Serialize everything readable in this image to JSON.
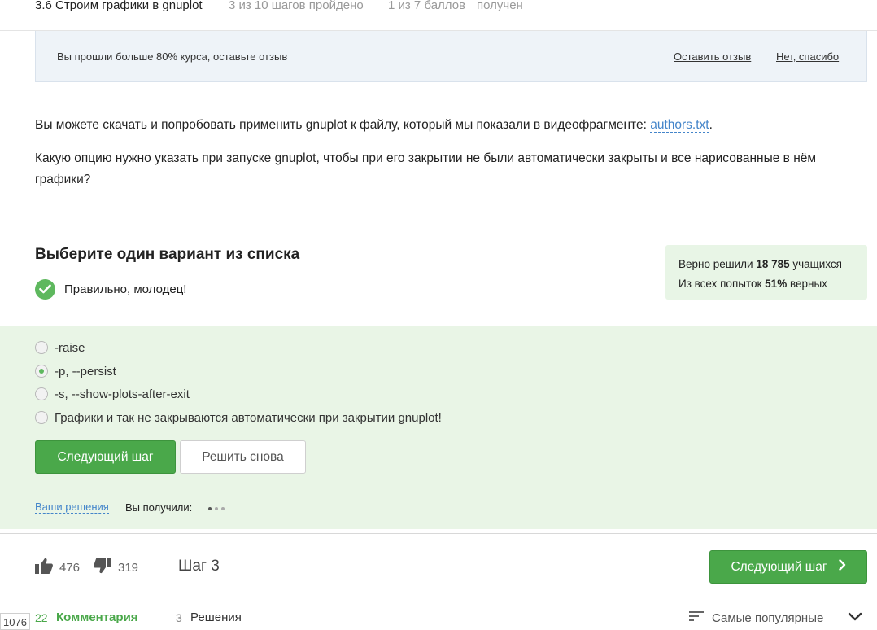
{
  "header": {
    "breadcrumb": "3.6 Строим графики в gnuplot",
    "steps_progress": "3 из 10 шагов пройдено",
    "points_progress": "1 из 7 баллов",
    "points_suffix": "получен"
  },
  "banner": {
    "message": "Вы прошли больше 80% курса, оставьте отзыв",
    "leave_review": "Оставить отзыв",
    "no_thanks": "Нет, спасибо"
  },
  "content": {
    "download_text": "Вы можете скачать и попробовать применить gnuplot к файлу, который мы показали в видеофрагменте: ",
    "download_link": "authors.txt",
    "download_end": ".",
    "question": "Какую опцию нужно указать при запуске gnuplot, чтобы при его закрытии не были автоматически закрыты и все нарисованные в нём графики?"
  },
  "quiz": {
    "title": "Выберите один вариант из списка",
    "status": "Правильно, молодец!",
    "stats": {
      "solved_prefix": "Верно решили",
      "solved_count": "18 785",
      "solved_suffix": "учащихся",
      "attempts_prefix": "Из всех попыток",
      "attempts_percent": "51%",
      "attempts_suffix": "верных"
    },
    "options": [
      {
        "label": "-raise",
        "selected": false
      },
      {
        "label": "-p, --persist",
        "selected": true
      },
      {
        "label": "-s, --show-plots-after-exit",
        "selected": false
      },
      {
        "label": "Графики и так не закрываются автоматически при закрытии gnuplot!",
        "selected": false
      }
    ],
    "next_button": "Следующий шаг",
    "retry_button": "Решить снова",
    "your_solutions": "Ваши решения",
    "you_got": "Вы получили:"
  },
  "footer": {
    "likes": "476",
    "dislikes": "319",
    "step_label": "Шаг 3",
    "next_button": "Следующий шаг",
    "comments_count": "22",
    "comments_label": "Комментария",
    "solutions_count": "3",
    "solutions_label": "Решения",
    "sort_label": "Самые популярные",
    "step_id": "1076"
  },
  "colors": {
    "accent_green": "#4aa84a",
    "success_bg": "#e9f5e6",
    "link_blue": "#4485ca",
    "banner_bg": "#eef3f8"
  },
  "icons": [
    "check-icon",
    "thumbs-up-icon",
    "thumbs-down-icon",
    "chevron-right-icon",
    "sort-icon",
    "chevron-down-icon"
  ]
}
